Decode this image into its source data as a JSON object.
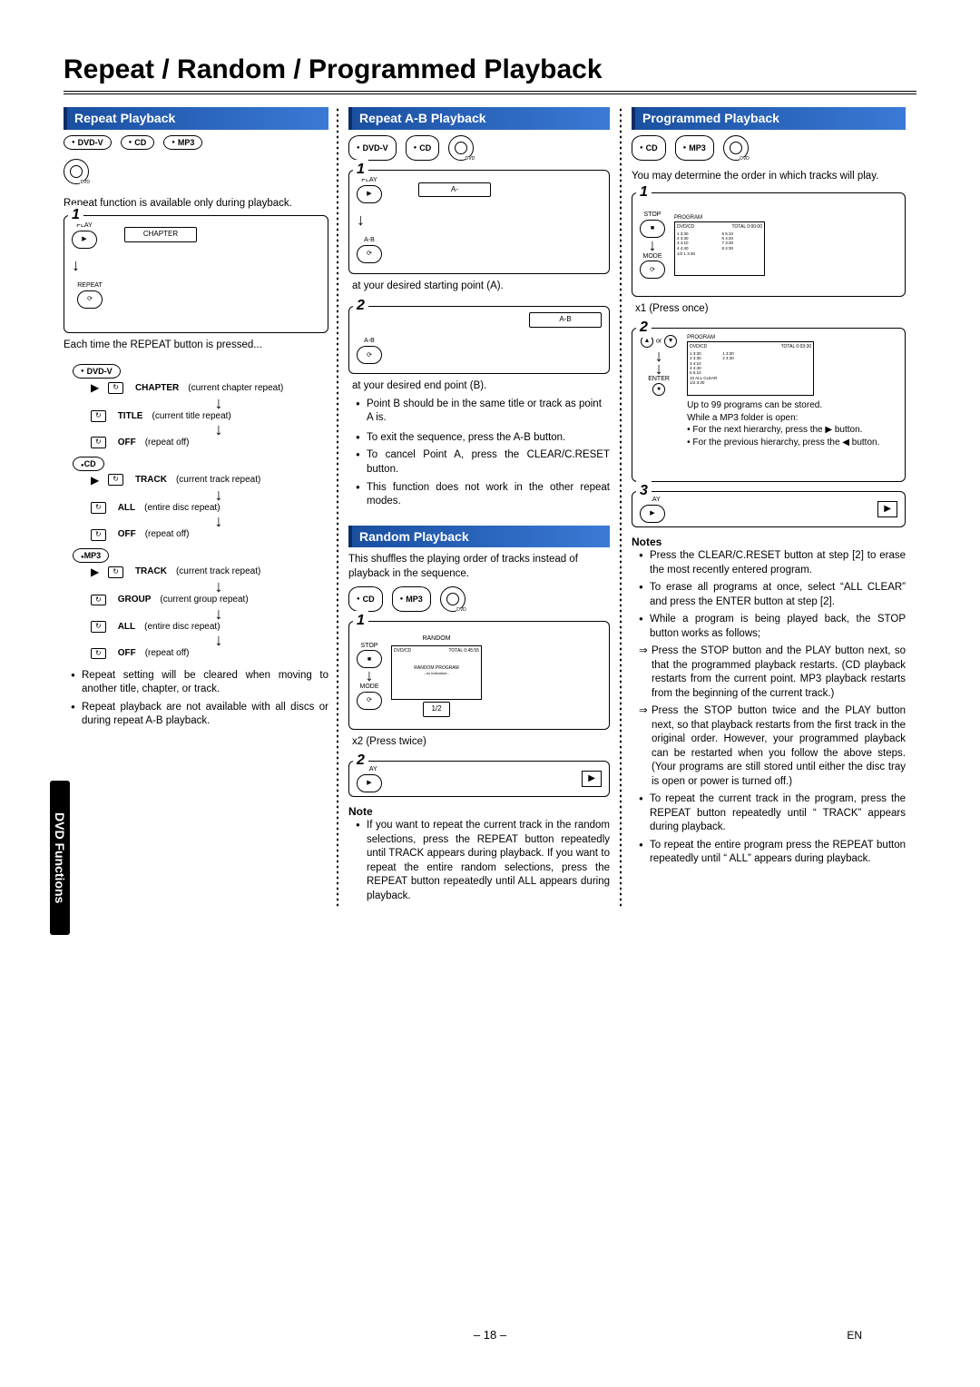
{
  "page_title": "Repeat / Random / Programmed Playback",
  "side_tab": "DVD Functions",
  "footer": {
    "page": "– 18 –",
    "lang": "EN"
  },
  "col1": {
    "header": "Repeat Playback",
    "discs": [
      "DVD-V",
      "CD",
      "MP3"
    ],
    "intro": "Repeat function is available only during playback.",
    "step1": {
      "n": "1",
      "btn_top": "PLAY",
      "osd": "CHAPTER",
      "btn_bot": "REPEAT"
    },
    "each_time": "Each time the REPEAT button is pressed...",
    "dvdv_label": "DVD-V",
    "dvd_lines": [
      {
        "mode": "CHAPTER",
        "lab": "CHAPTER",
        "desc": "(current chapter repeat)"
      },
      {
        "mode": "TITLE",
        "lab": "TITLE",
        "desc": "(current title repeat)"
      },
      {
        "mode": "OFF",
        "lab": "OFF",
        "desc": "(repeat off)"
      }
    ],
    "cd_label": "CD",
    "cd_lines": [
      {
        "mode": "TRACK",
        "lab": "TRACK",
        "desc": "(current track repeat)"
      },
      {
        "mode": "ALL",
        "lab": "ALL",
        "desc": "(entire disc repeat)"
      },
      {
        "mode": "OFF",
        "lab": "OFF",
        "desc": "(repeat off)"
      }
    ],
    "mp3_label": "MP3",
    "mp3_lines": [
      {
        "mode": "TRACK",
        "lab": "TRACK",
        "desc": "(current track repeat)"
      },
      {
        "mode": "GROUP",
        "lab": "GROUP",
        "desc": "(current group repeat)"
      },
      {
        "mode": "ALL",
        "lab": "ALL",
        "desc": "(entire disc repeat)"
      },
      {
        "mode": "OFF",
        "lab": "OFF",
        "desc": "(repeat off)"
      }
    ],
    "notes": [
      "Repeat setting will be cleared when moving to another title, chapter, or track.",
      "Repeat playback are not available with all discs or during repeat A-B playback."
    ]
  },
  "col2a": {
    "header": "Repeat A-B Playback",
    "discs": [
      "DVD-V",
      "CD"
    ],
    "step1": {
      "n": "1",
      "btn_top": "PLAY",
      "osd": "A-",
      "btn_bot": "A-B",
      "caption": "at your desired starting point (A)."
    },
    "step2": {
      "n": "2",
      "osd": "A-B",
      "btn_bot": "A-B",
      "caption": "at your desired end point (B)."
    },
    "sub": "Point B should be in the same title or track as point A is.",
    "bullets": [
      "To exit the sequence, press the A-B button.",
      "To cancel Point A, press the CLEAR/C.RESET button.",
      "This function does not work in the other repeat modes."
    ]
  },
  "col2b": {
    "header": "Random Playback",
    "intro": "This shuffles the playing order of tracks instead of playback in the sequence.",
    "discs": [
      "CD",
      "MP3"
    ],
    "step1": {
      "n": "1",
      "btn_top": "STOP",
      "btn_bot": "MODE",
      "screen_hdr_left": "RANDOM",
      "screen_hdr_dvd": "DVD/CD",
      "screen_hdr_right": "TOTAL 0:45:55",
      "screen_line1": "RANDOM PROGRAM",
      "screen_line2": "--no indication--",
      "screen_tag": "1/2",
      "press": "x2 (Press twice)"
    },
    "step2": {
      "n": "2",
      "btn": "PLAY",
      "icon": "▶"
    },
    "note_h": "Note",
    "note": "If you want to repeat the current track in the random selections, press the REPEAT button repeatedly until      TRACK appears during playback. If you want to repeat the entire random selections, press the REPEAT button repeatedly until      ALL appears during playback."
  },
  "col3": {
    "header": "Programmed Playback",
    "discs": [
      "CD",
      "MP3"
    ],
    "intro": "You may determine the order in which tracks will play.",
    "step1": {
      "n": "1",
      "btn_top": "STOP",
      "btn_bot": "MODE",
      "screen_title": "PROGRAM",
      "screen_hdr_dvd": "DVD/CD",
      "screen_hdr_right": "TOTAL 0:00:00",
      "screen_rows": [
        "1  3:30",
        "2  4:30",
        "3  4:10",
        "4  4:40",
        "5  5:10",
        "6  4:40",
        "7  3:30",
        "8  4:30"
      ],
      "screen_footer": "1/2   1  3:30",
      "press": "x1 (Press once)"
    },
    "step2": {
      "n": "2",
      "screen_title": "PROGRAM",
      "screen_hdr_dvd": "DVD/CD",
      "screen_hdr_right": "TOTAL 0:03:30",
      "screen_left": [
        "1  3:30",
        "2  4:30",
        "3  4:10",
        "4  4:40",
        "5  5:10",
        "10 ALL CLEAR"
      ],
      "screen_right": [
        "1  3:30",
        "2  4:30"
      ],
      "screen_footer": "1/2   3:30",
      "caption1": "Up to 99 programs can be stored.",
      "caption2": "While a MP3 folder is open:",
      "caption3": "• For the next hierarchy, press the ▶ button.",
      "caption4": "• For the previous hierarchy, press the ◀ button.",
      "enter_lbl": "ENTER"
    },
    "step3": {
      "n": "3",
      "btn": "PLAY",
      "icon": "▶"
    },
    "notes_h": "Notes",
    "notes": [
      "Press the CLEAR/C.RESET button at step [2] to erase the most recently entered program.",
      "To erase all programs at once, select “ALL CLEAR” and press the ENTER button at step [2].",
      "While a program is being played back, the STOP button works as follows;"
    ],
    "sub_notes": [
      "Press the STOP button and the PLAY button next, so that the programmed playback restarts. (CD playback restarts from the current point. MP3 playback restarts from the beginning of the current track.)",
      "Press the STOP button twice and the PLAY button next, so that playback restarts from the first track in the original order. However, your programmed playback can be restarted when you follow the above steps. (Your programs are still stored until either the disc tray is open or power is turned off.)"
    ],
    "notes2": [
      "To repeat the current track in the program, press the REPEAT button repeatedly until “     TRACK” appears during playback.",
      "To repeat the entire program press the REPEAT button repeatedly until “     ALL” appears during playback."
    ]
  }
}
